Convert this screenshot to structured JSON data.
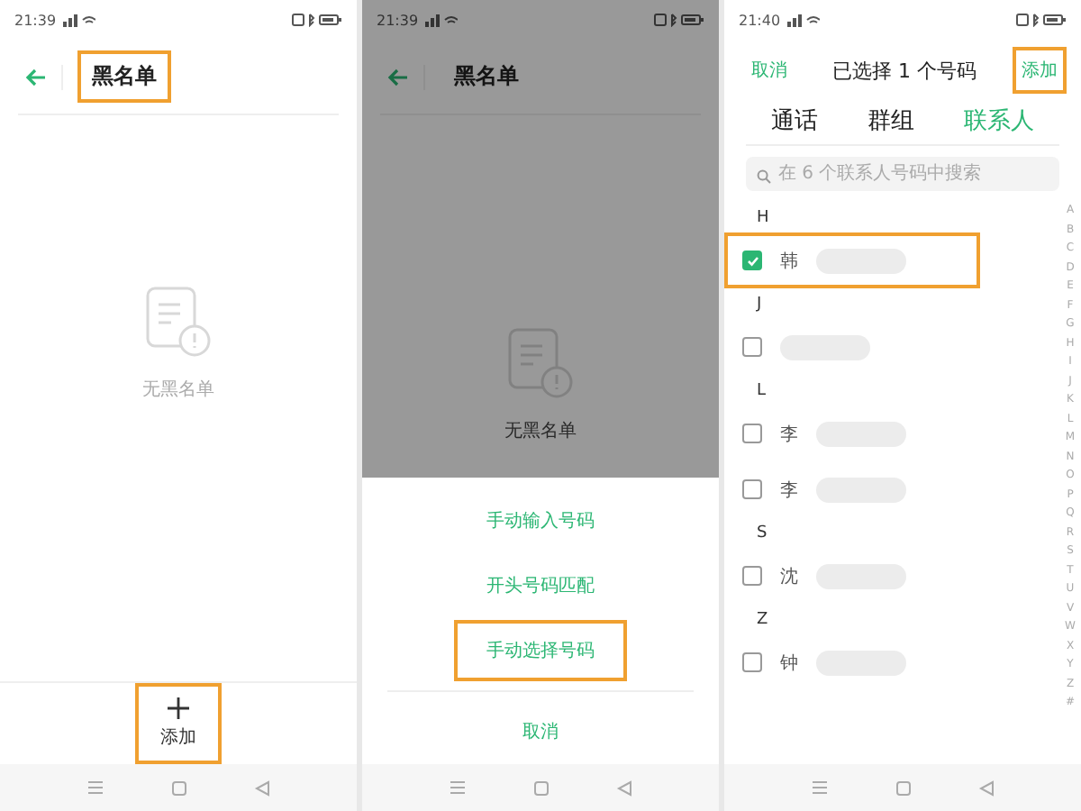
{
  "screens": [
    {
      "kind": "blacklist",
      "time": "21:39",
      "title": "黑名单",
      "title_highlighted": true,
      "empty_text": "无黑名单",
      "add_label": "添加",
      "add_highlighted": true
    },
    {
      "kind": "sheet",
      "time": "21:39",
      "title": "黑名单",
      "empty_text": "无黑名单",
      "options": [
        {
          "label": "手动输入号码",
          "highlighted": false
        },
        {
          "label": "开头号码匹配",
          "highlighted": false
        },
        {
          "label": "手动选择号码",
          "highlighted": true
        }
      ],
      "cancel": "取消"
    },
    {
      "kind": "picker",
      "time": "21:40",
      "cancel": "取消",
      "title": "已选择 1 个号码",
      "add_label": "添加",
      "add_highlighted": true,
      "tabs": [
        {
          "label": "通话",
          "selected": false
        },
        {
          "label": "群组",
          "selected": false
        },
        {
          "label": "联系人",
          "selected": true
        }
      ],
      "search_placeholder": "在 6 个联系人号码中搜索",
      "sections": [
        {
          "letter": "H",
          "contacts": [
            {
              "name": "韩",
              "checked": true,
              "highlighted": true
            }
          ]
        },
        {
          "letter": "J",
          "contacts": [
            {
              "checked": false,
              "highlighted": false
            }
          ]
        },
        {
          "letter": "L",
          "contacts": [
            {
              "name": "李",
              "checked": false,
              "highlighted": false
            },
            {
              "name": "李",
              "checked": false,
              "highlighted": false
            }
          ]
        },
        {
          "letter": "S",
          "contacts": [
            {
              "name": "沈",
              "checked": false,
              "highlighted": false
            }
          ]
        },
        {
          "letter": "Z",
          "contacts": [
            {
              "name": "钟",
              "checked": false,
              "highlighted": false
            }
          ]
        }
      ],
      "index": [
        "A",
        "B",
        "C",
        "D",
        "E",
        "F",
        "G",
        "H",
        "I",
        "J",
        "K",
        "L",
        "M",
        "N",
        "O",
        "P",
        "Q",
        "R",
        "S",
        "T",
        "U",
        "V",
        "W",
        "X",
        "Y",
        "Z",
        "#"
      ]
    }
  ]
}
